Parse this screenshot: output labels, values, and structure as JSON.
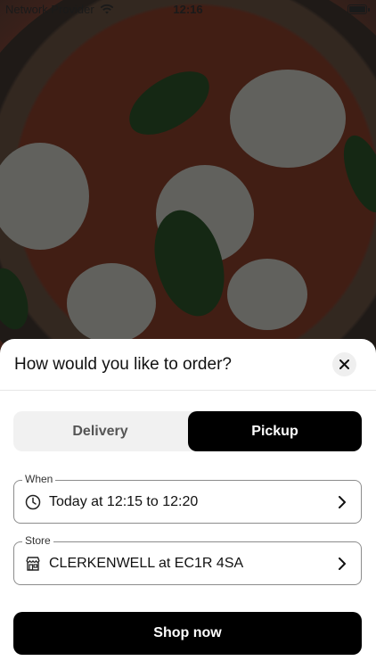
{
  "status_bar": {
    "carrier": "Network Provider",
    "time": "12:16",
    "wifi_icon": "wifi-icon",
    "battery_icon": "battery-icon"
  },
  "sheet": {
    "title": "How would you like to order?",
    "close_icon": "close-icon",
    "segment": {
      "options": [
        {
          "label": "Delivery",
          "selected": false
        },
        {
          "label": "Pickup",
          "selected": true
        }
      ]
    },
    "when": {
      "legend": "When",
      "value": "Today at 12:15 to 12:20",
      "icon": "clock-icon"
    },
    "store": {
      "legend": "Store",
      "value": "CLERKENWELL at EC1R 4SA",
      "icon": "store-icon"
    },
    "shop_button": "Shop now"
  },
  "colors": {
    "primary": "#000000",
    "segment_bg": "#f1f1f1",
    "field_border": "#8c8c8c"
  }
}
